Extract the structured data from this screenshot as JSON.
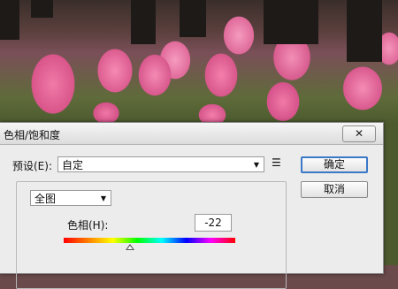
{
  "dialog": {
    "title": "色相/饱和度",
    "close_label": "",
    "preset_label": "预设(E):",
    "preset_value": "自定",
    "preset_menu_icon": "list-options-icon",
    "ok_label": "确定",
    "cancel_label": "取消",
    "channel_value": "全图",
    "hue_label": "色相(H):",
    "hue_value": "-22",
    "hue_slider_level": -22,
    "hue_slider_range": [
      -180,
      180
    ]
  },
  "colors": {
    "default_button_border": "#3a78c8",
    "dialog_background": "#ececec"
  }
}
